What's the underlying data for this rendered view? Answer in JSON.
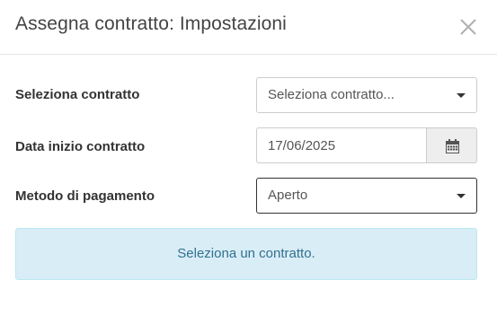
{
  "modal": {
    "title": "Assegna contratto: Impostazioni"
  },
  "form": {
    "contract": {
      "label": "Seleziona contratto",
      "selected": "Seleziona contratto..."
    },
    "start_date": {
      "label": "Data inizio contratto",
      "value": "17/06/2025"
    },
    "payment_method": {
      "label": "Metodo di pagamento",
      "selected": "Aperto"
    }
  },
  "alert": {
    "message": "Seleziona un contratto."
  },
  "icons": {
    "close": "close-icon",
    "calendar": "calendar-icon",
    "dropdown": "chevron-down-icon"
  },
  "colors": {
    "alert_background": "#d9edf7",
    "alert_text": "#31708f",
    "addon_background": "#eeeeee"
  }
}
